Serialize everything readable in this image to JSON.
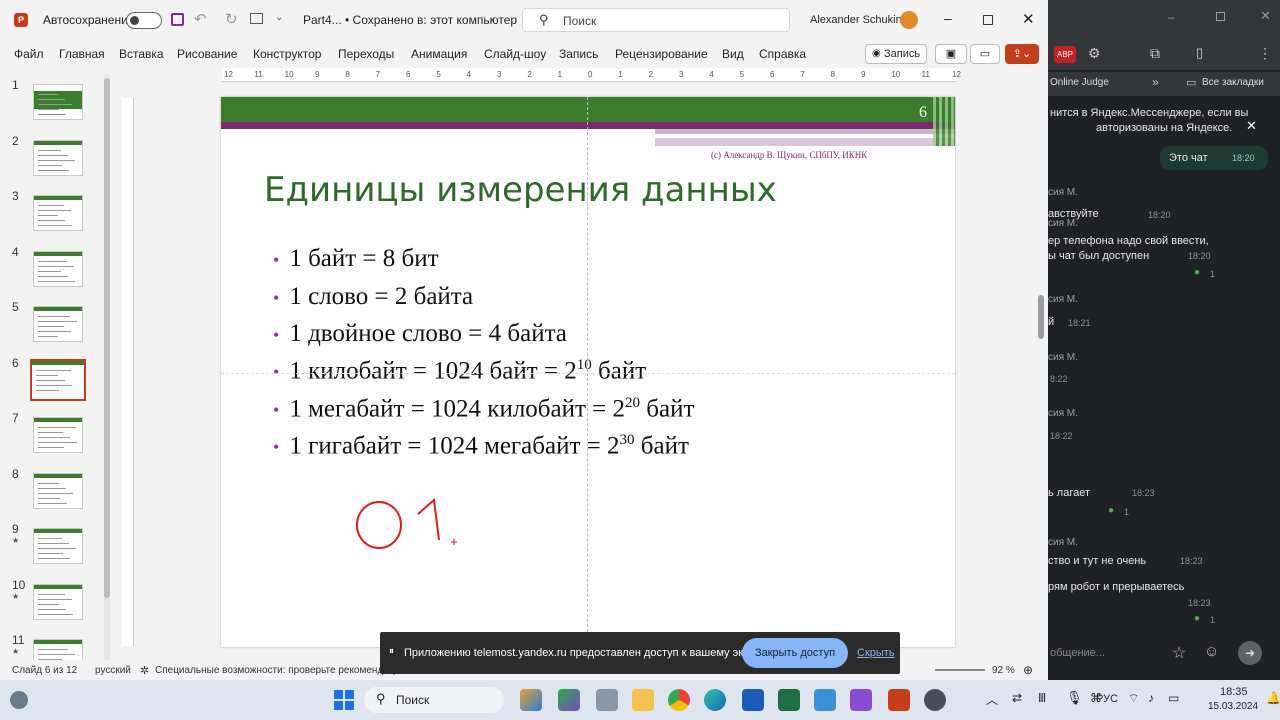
{
  "titlebar": {
    "autosave_label": "Автосохранение",
    "doc_title": "Part4... • Сохранено в: этот компьютер",
    "search_placeholder": "Поиск",
    "user_name": "Alexander Schukin"
  },
  "ribbon": {
    "tabs": [
      "Файл",
      "Главная",
      "Вставка",
      "Рисование",
      "Конструктор",
      "Переходы",
      "Анимация",
      "Слайд-шоу",
      "Запись",
      "Рецензирование",
      "Вид",
      "Справка"
    ],
    "record_label": "Запись"
  },
  "ruler": {
    "labels": [
      "12",
      "11",
      "10",
      "9",
      "8",
      "7",
      "6",
      "5",
      "4",
      "3",
      "2",
      "1",
      "0",
      "1",
      "2",
      "3",
      "4",
      "5",
      "6",
      "7",
      "8",
      "9",
      "10",
      "11",
      "12"
    ]
  },
  "thumbnails": {
    "numbers": [
      "1",
      "2",
      "3",
      "4",
      "5",
      "6",
      "7",
      "8",
      "9",
      "10",
      "11"
    ],
    "selected": "6",
    "star_marks": [
      "9",
      "10",
      "11"
    ]
  },
  "slide": {
    "page_number": "6",
    "copyright": "(c) Александр В. Щукин, СПбПУ, ИКНК",
    "title": "Единицы измерения данных",
    "bullets": [
      {
        "text": "1 байт = 8 бит",
        "exp": "",
        "tail": ""
      },
      {
        "text": "1 слово = 2 байта",
        "exp": "",
        "tail": ""
      },
      {
        "text": "1 двойное слово = 4 байта",
        "exp": "",
        "tail": ""
      },
      {
        "text": "1 килобайт = 1024 байт = 2",
        "exp": "10",
        "tail": " байт"
      },
      {
        "text": "1 мегабайт = 1024 килобайт = 2",
        "exp": "20",
        "tail": " байт"
      },
      {
        "text": "1 гигабайт = 1024 мегабайт = 2",
        "exp": "30",
        "tail": " байт"
      }
    ],
    "colors": {
      "green": "#3a7d2a",
      "purple": "#7b2b6e",
      "title": "#2f6a2a",
      "bullet": "#8b3a8a",
      "ink": "#d62020"
    }
  },
  "status": {
    "slide_info": "Слайд 6 из 12",
    "language": "русский",
    "accessibility": "Специальные возможности: проверьте рекомендации",
    "zoom": "92 %"
  },
  "share_banner": {
    "text": "Приложению telemost.yandex.ru предоставлен доступ к вашему экрану.",
    "stop_button": "Закрыть доступ",
    "hide_link": "Скрыть"
  },
  "browser": {
    "bookmark_online_judge": "Online Judge",
    "bookmark_all": "Все закладки"
  },
  "chat": {
    "notice": "нится в Яндекс.Мессенджере, если вы авторизованы на Яндексе.",
    "notice_line1": "нится в Яндекс.Мессенджере, если вы",
    "notice_line2": "авторизованы на Яндексе.",
    "this_chat": "Это чат",
    "this_chat_time": "18:20",
    "messages": [
      {
        "sender": "сия М.",
        "line1": "авствуйте",
        "line2": "",
        "time": "18:20"
      },
      {
        "sender": "сия М.",
        "line1": "ер телефона надо свой ввести,",
        "line2": "ы чат был доступен",
        "time": "18:20"
      },
      {
        "sender": "сия М.",
        "line1": "й",
        "line2": "",
        "time": "18:21"
      },
      {
        "sender": "сия М.",
        "line1": "",
        "line2": "",
        "time": "8:22"
      },
      {
        "sender": "сия М.",
        "line1": "",
        "line2": "",
        "time": "18:22"
      },
      {
        "sender": "",
        "line1": "ь лагает",
        "line2": "",
        "time": "18:23"
      },
      {
        "sender": "сия М.",
        "line1": "ство и тут не очень",
        "line2": "",
        "time": "18:23"
      },
      {
        "sender": "",
        "line1": "рям робот и прерываетесь",
        "line2": "",
        "time": "18:23"
      }
    ],
    "reaction_count": "1",
    "input_placeholder": "общение..."
  },
  "taskbar": {
    "search_label": "Поиск",
    "lang": "РУС",
    "time": "18:35",
    "date": "15.03.2024"
  }
}
